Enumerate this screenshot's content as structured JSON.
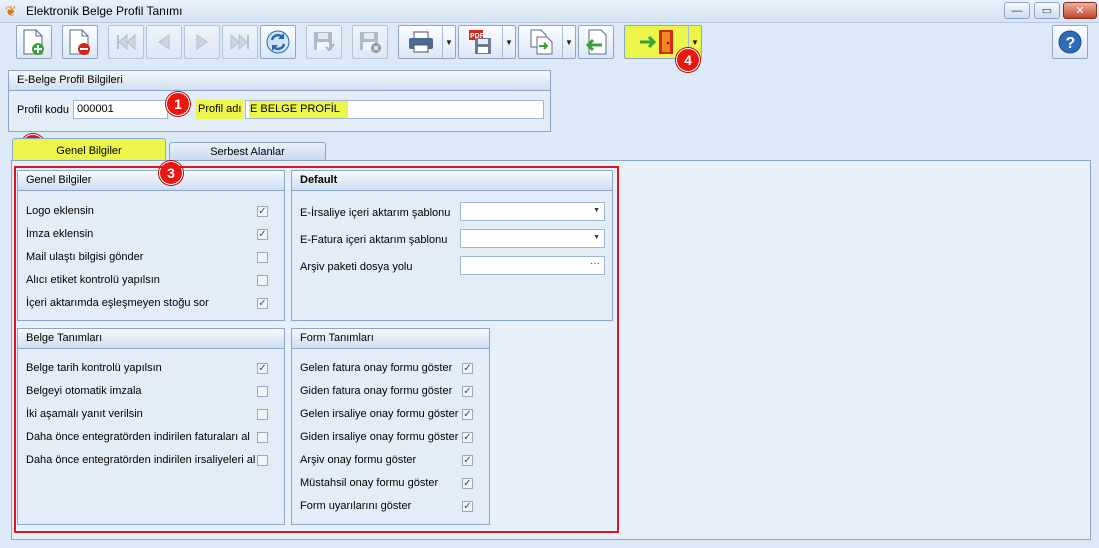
{
  "window": {
    "title": "Elektronik Belge Profil Tanımı",
    "minimize": "—",
    "maximize": "▭",
    "close": "✕"
  },
  "toolbar": {
    "buttons": [
      {
        "name": "new",
        "icon": "new-document-icon"
      },
      {
        "name": "delete",
        "icon": "delete-document-icon"
      },
      {
        "name": "first",
        "icon": "first-record-icon"
      },
      {
        "name": "previous",
        "icon": "previous-record-icon"
      },
      {
        "name": "next",
        "icon": "next-record-icon"
      },
      {
        "name": "last",
        "icon": "last-record-icon"
      },
      {
        "name": "refresh",
        "icon": "refresh-icon"
      },
      {
        "name": "save",
        "icon": "save-icon"
      },
      {
        "name": "save-close",
        "icon": "save-close-icon"
      },
      {
        "name": "print",
        "icon": "printer-icon"
      },
      {
        "name": "export-pdf",
        "icon": "pdf-export-icon"
      },
      {
        "name": "import-export",
        "icon": "transfer-icon"
      },
      {
        "name": "back",
        "icon": "back-arrow-icon"
      },
      {
        "name": "exit",
        "icon": "exit-door-icon"
      },
      {
        "name": "help",
        "icon": "help-icon"
      }
    ]
  },
  "badges": {
    "b1": "1",
    "b2": "2",
    "b3": "3",
    "b4": "4"
  },
  "profile_group": {
    "title": "E-Belge Profil Bilgileri",
    "code_label": "Profil kodu",
    "code_value": "000001",
    "name_label": "Profil adı",
    "name_value": "E BELGE PROFİL"
  },
  "tabs": [
    {
      "label": "Genel Bilgiler",
      "active": true
    },
    {
      "label": "Serbest Alanlar",
      "active": false
    }
  ],
  "genel": {
    "title": "Genel Bilgiler",
    "items": [
      {
        "label": "Logo eklensin",
        "checked": true
      },
      {
        "label": "İmza eklensin",
        "checked": true
      },
      {
        "label": "Mail ulaştı bilgisi gönder",
        "checked": false
      },
      {
        "label": "Alıcı etiket kontrolü yapılsın",
        "checked": false
      },
      {
        "label": "İçeri aktarımda eşleşmeyen stoğu sor",
        "checked": true
      }
    ]
  },
  "default": {
    "title": "Default",
    "fields": [
      {
        "label": "E-İrsaliye içeri aktarım şablonu",
        "value": "",
        "kind": "combo"
      },
      {
        "label": "E-Fatura içeri aktarım şablonu",
        "value": "",
        "kind": "combo"
      },
      {
        "label": "Arşiv paketi dosya yolu",
        "value": "",
        "kind": "browse"
      }
    ]
  },
  "belge": {
    "title": "Belge Tanımları",
    "items": [
      {
        "label": "Belge tarih kontrolü yapılsın",
        "checked": true
      },
      {
        "label": "Belgeyi otomatik imzala",
        "checked": false
      },
      {
        "label": "İki aşamalı yanıt verilsin",
        "checked": false
      },
      {
        "label": "Daha önce entegratörden indirilen faturaları al",
        "checked": false
      },
      {
        "label": "Daha önce entegratörden indirilen irsaliyeleri al",
        "checked": false
      }
    ]
  },
  "form": {
    "title": "Form Tanımları",
    "items": [
      {
        "label": "Gelen fatura onay formu göster",
        "checked": true
      },
      {
        "label": "Giden fatura onay formu göster",
        "checked": true
      },
      {
        "label": "Gelen irsaliye onay formu göster",
        "checked": true
      },
      {
        "label": "Giden irsaliye onay formu göster",
        "checked": true
      },
      {
        "label": "Arşiv onay formu göster",
        "checked": true
      },
      {
        "label": "Müstahsil onay formu göster",
        "checked": true
      },
      {
        "label": "Form uyarılarını göster",
        "checked": true
      }
    ]
  },
  "colors": {
    "highlight": "#ecf54a",
    "badge": "#e8170f",
    "panel_border": "#8aa7c9"
  }
}
